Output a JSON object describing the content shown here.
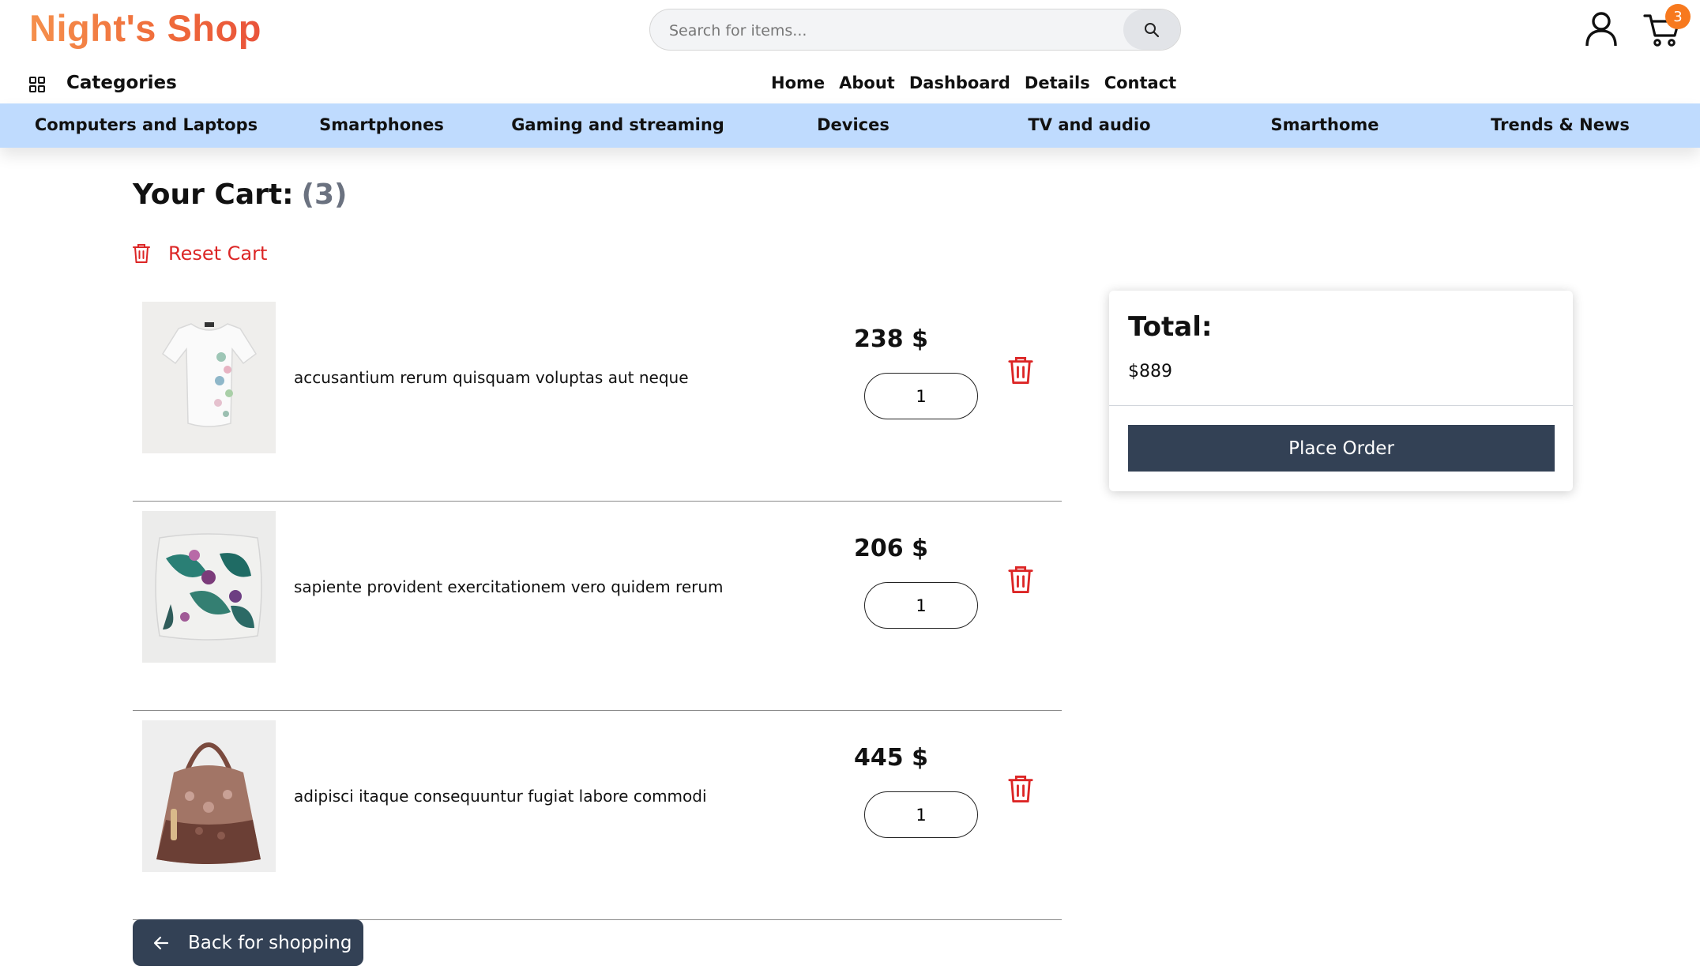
{
  "brand": {
    "logo_text": "Night's Shop"
  },
  "search": {
    "placeholder": "Search for items..."
  },
  "header_icons": {
    "user": "user-icon",
    "cart": "cart-icon",
    "cart_count": "3"
  },
  "categories_menu": {
    "label": "Categories",
    "icon": "grid-icon"
  },
  "top_nav": [
    "Home",
    "About",
    "Dashboard",
    "Details",
    "Contact"
  ],
  "category_bar": [
    "Computers and Laptops",
    "Smartphones",
    "Gaming and streaming",
    "Devices",
    "TV and audio",
    "Smarthome",
    "Trends & News"
  ],
  "cart": {
    "title": "Your Cart:",
    "count": "(3)",
    "reset_label": "Reset Cart",
    "items": [
      {
        "name": "accusantium rerum quisquam voluptas aut neque",
        "price": "238 $",
        "quantity": "1",
        "image": "white floral t-shirt"
      },
      {
        "name": "sapiente provident exercitationem vero quidem rerum",
        "price": "206 $",
        "quantity": "1",
        "image": "tropical leaf pillow"
      },
      {
        "name": "adipisci itaque consequuntur fugiat labore commodi",
        "price": "445 $",
        "quantity": "1",
        "image": "brown lace handbag"
      }
    ],
    "back_label": "Back for shopping"
  },
  "summary": {
    "total_label": "Total:",
    "total_value": "$889",
    "place_order_label": "Place Order"
  },
  "colors": {
    "accent_dark": "#334155",
    "category_bar": "#bfdbfe",
    "danger": "#dc2626",
    "badge": "#f7791e",
    "logo_start": "#f5904c",
    "logo_end": "#e9533b"
  }
}
